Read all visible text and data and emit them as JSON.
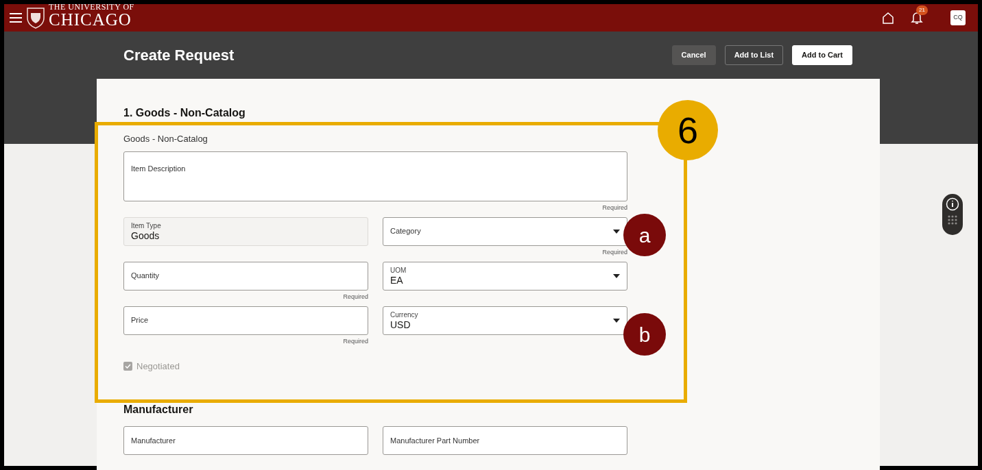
{
  "header": {
    "logo_line1": "THE UNIVERSITY OF",
    "logo_line2": "CHICAGO",
    "notification_count": "21",
    "avatar": "CQ"
  },
  "page": {
    "title": "Create Request",
    "actions": [
      {
        "label": "Cancel",
        "kind": "secondary"
      },
      {
        "label": "Add to List",
        "kind": "outline"
      },
      {
        "label": "Add to Cart",
        "kind": "primary"
      }
    ]
  },
  "section": {
    "title": "1. Goods - Non-Catalog",
    "subtitle": "Goods - Non-Catalog",
    "rows": [
      [
        {
          "kind": "textarea",
          "label": "Item Description",
          "note": "Required"
        }
      ],
      [
        {
          "kind": "readonly",
          "label": "Item Type",
          "value": "Goods"
        },
        {
          "kind": "select",
          "label": "Category",
          "note": "Required"
        }
      ],
      [
        {
          "kind": "text",
          "label": "Quantity",
          "note": "Required"
        },
        {
          "kind": "select",
          "label": "UOM",
          "value": "EA"
        }
      ],
      [
        {
          "kind": "text",
          "label": "Price",
          "note": "Required"
        },
        {
          "kind": "select",
          "label": "Currency",
          "value": "USD"
        }
      ]
    ],
    "checkbox": {
      "label": "Negotiated",
      "checked": true,
      "disabled": true
    }
  },
  "manufacturer": {
    "title": "Manufacturer",
    "rows": [
      [
        {
          "kind": "text",
          "label": "Manufacturer"
        },
        {
          "kind": "text",
          "label": "Manufacturer Part Number"
        }
      ]
    ]
  },
  "annotations": [
    {
      "kind": "box",
      "label": "6"
    },
    {
      "kind": "marker",
      "label": "a"
    },
    {
      "kind": "marker",
      "label": "b"
    }
  ]
}
